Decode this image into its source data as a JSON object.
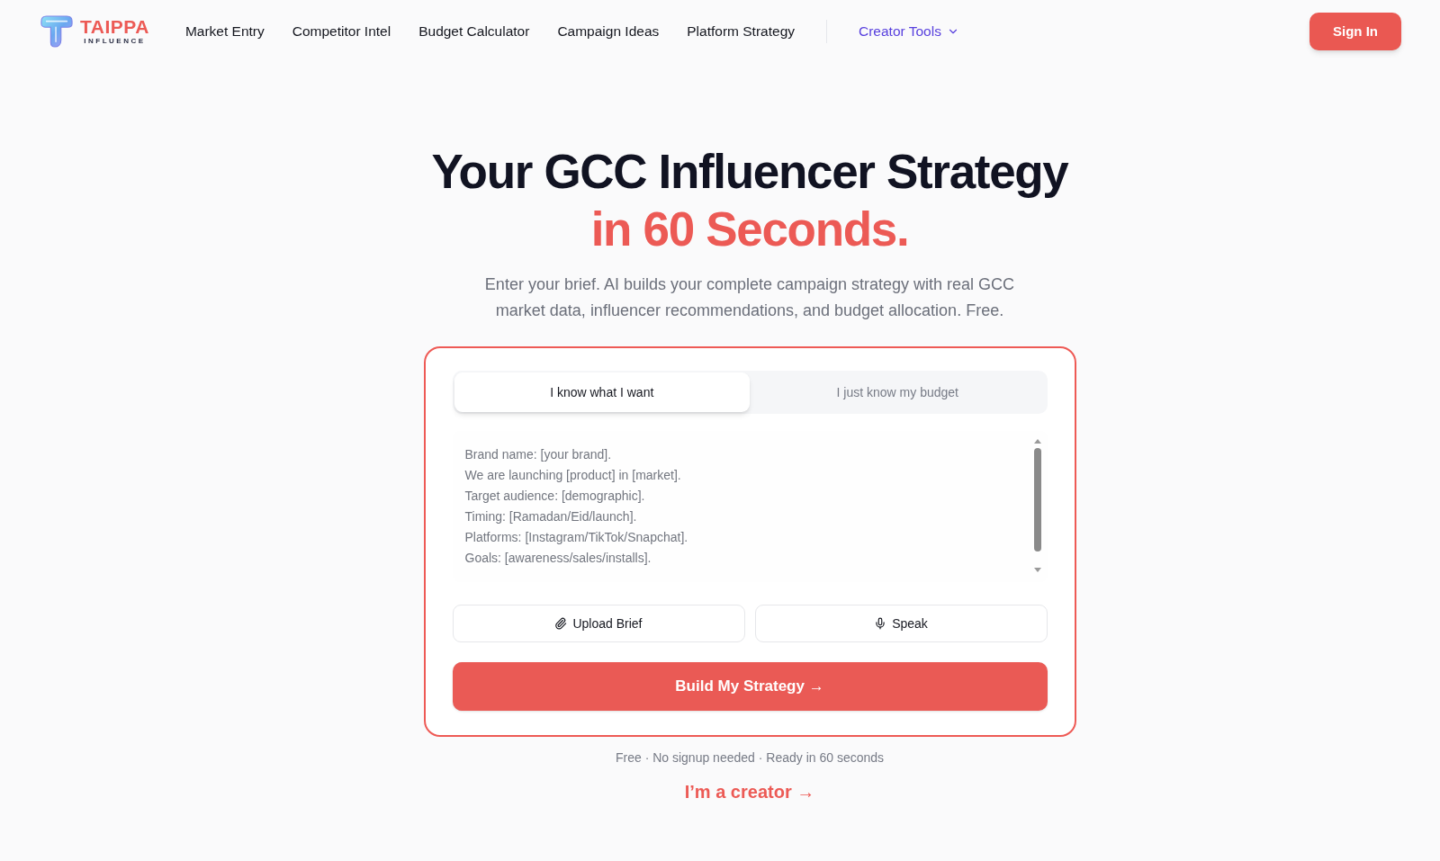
{
  "nav": {
    "logo": {
      "name": "TAIPPA",
      "tagline": "INFLUENCE"
    },
    "links": [
      "Market Entry",
      "Competitor Intel",
      "Budget Calculator",
      "Campaign Ideas",
      "Platform Strategy"
    ],
    "menu": {
      "label": "Creator Tools"
    },
    "sign_in": "Sign In"
  },
  "hero": {
    "title": "Your GCC Influencer Strategy",
    "title_highlight": "in 60 Seconds.",
    "subtitle": "Enter your brief. AI builds your complete campaign strategy with real GCC market data, influencer recommendations, and budget allocation. Free."
  },
  "brief_card": {
    "tabs": [
      {
        "label": "I know what I want",
        "selected": true
      },
      {
        "label": "I just know my budget",
        "selected": false
      }
    ],
    "brief": {
      "placeholder": "Brand name: [your brand].\nWe are launching [product] in [market].\nTarget audience: [demographic].\nTiming: [Ramadan/Eid/launch].\nPlatforms: [Instagram/TikTok/Snapchat].\nGoals: [awareness/sales/installs]."
    },
    "actions": [
      {
        "kind": "upload",
        "label": "Upload Brief"
      },
      {
        "kind": "voice",
        "label": "Speak"
      }
    ],
    "submit": "Build My Strategy →"
  },
  "note": "Free · No signup needed · Ready in 60 seconds",
  "creator_link": "I’m a creator →"
}
